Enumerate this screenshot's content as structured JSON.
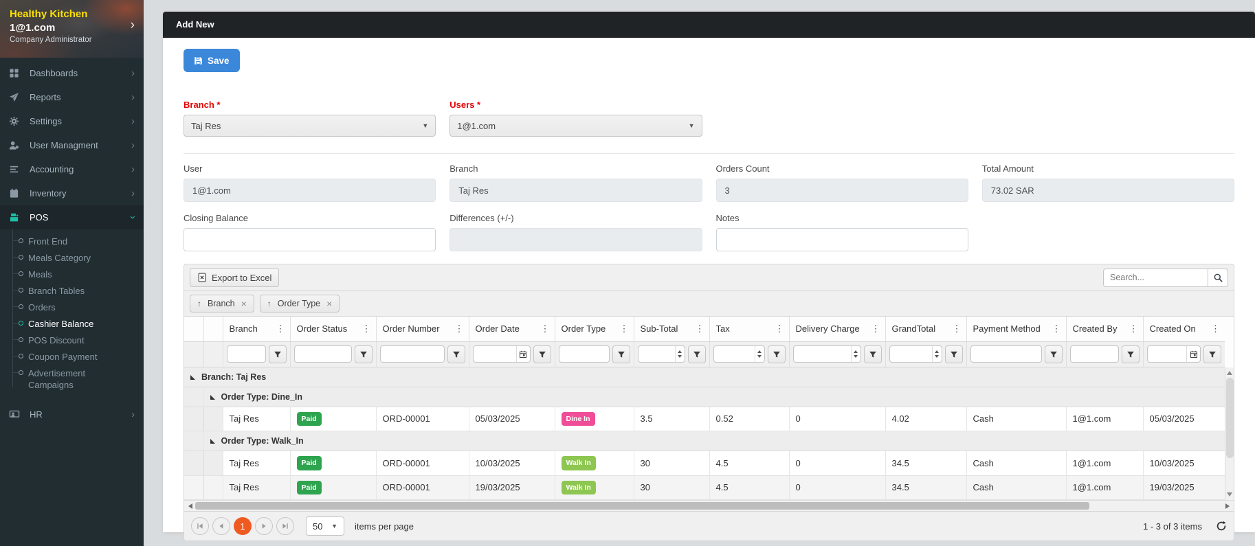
{
  "colors": {
    "brand-yellow": "#ffe100",
    "accent-teal": "#1dbfa5",
    "save-blue": "#3b87da",
    "required-red": "#e60000",
    "header-dark": "#1f2326",
    "paid-green": "#2ea44f",
    "dine-in-pink": "#ef4d97",
    "walk-in-green": "#8dc650",
    "pager-orange": "#ef5a21"
  },
  "sidebar": {
    "brand": "Healthy Kitchen",
    "account": "1@1.com",
    "role": "Company Administrator",
    "items": [
      {
        "label": "Dashboards"
      },
      {
        "label": "Reports"
      },
      {
        "label": "Settings"
      },
      {
        "label": "User Managment"
      },
      {
        "label": "Accounting"
      },
      {
        "label": "Inventory"
      },
      {
        "label": "POS"
      },
      {
        "label": "HR"
      }
    ],
    "pos_submenu": [
      {
        "label": "Front End"
      },
      {
        "label": "Meals Category"
      },
      {
        "label": "Meals"
      },
      {
        "label": "Branch Tables"
      },
      {
        "label": "Orders"
      },
      {
        "label": "Cashier Balance"
      },
      {
        "label": "POS Discount"
      },
      {
        "label": "Coupon Payment"
      },
      {
        "label": "Advertisement Campaigns"
      }
    ]
  },
  "panel": {
    "title": "Add New"
  },
  "toolbar": {
    "save_label": "Save"
  },
  "form": {
    "branch_dd": {
      "label": "Branch *",
      "value": "Taj Res"
    },
    "users_dd": {
      "label": "Users *",
      "value": "1@1.com"
    },
    "user": {
      "label": "User",
      "value": "1@1.com"
    },
    "branch": {
      "label": "Branch",
      "value": "Taj Res"
    },
    "orders_count": {
      "label": "Orders Count",
      "value": "3"
    },
    "total_amount": {
      "label": "Total Amount",
      "value": "73.02 SAR"
    },
    "closing_balance": {
      "label": "Closing Balance",
      "value": ""
    },
    "differences": {
      "label": "Differences (+/-)",
      "value": ""
    },
    "notes": {
      "label": "Notes",
      "value": ""
    }
  },
  "grid": {
    "export_label": "Export to Excel",
    "search_placeholder": "Search...",
    "group_chips": [
      {
        "label": "Branch"
      },
      {
        "label": "Order Type"
      }
    ],
    "columns": [
      "Branch",
      "Order Status",
      "Order Number",
      "Order Date",
      "Order Type",
      "Sub-Total",
      "Tax",
      "Delivery Charge",
      "GrandTotal",
      "Payment Method",
      "Created By",
      "Created On"
    ],
    "group_rows": [
      {
        "label": "Branch: Taj Res"
      },
      {
        "label": "Order Type: Dine_In"
      },
      {
        "label": "Order Type: Walk_In"
      }
    ],
    "rows": [
      {
        "branch": "Taj Res",
        "order_status": "Paid",
        "order_number": "ORD-00001",
        "order_date": "05/03/2025",
        "order_type": "Dine In",
        "sub_total": "3.5",
        "tax": "0.52",
        "delivery_charge": "0",
        "grand_total": "4.02",
        "payment_method": "Cash",
        "created_by": "1@1.com",
        "created_on": "05/03/2025"
      },
      {
        "branch": "Taj Res",
        "order_status": "Paid",
        "order_number": "ORD-00001",
        "order_date": "10/03/2025",
        "order_type": "Walk In",
        "sub_total": "30",
        "tax": "4.5",
        "delivery_charge": "0",
        "grand_total": "34.5",
        "payment_method": "Cash",
        "created_by": "1@1.com",
        "created_on": "10/03/2025"
      },
      {
        "branch": "Taj Res",
        "order_status": "Paid",
        "order_number": "ORD-00001",
        "order_date": "19/03/2025",
        "order_type": "Walk In",
        "sub_total": "30",
        "tax": "4.5",
        "delivery_charge": "0",
        "grand_total": "34.5",
        "payment_method": "Cash",
        "created_by": "1@1.com",
        "created_on": "19/03/2025"
      }
    ],
    "pager": {
      "page": "1",
      "page_size": "50",
      "items_per_page_label": "items per page",
      "info": "1 - 3 of 3 items"
    }
  }
}
